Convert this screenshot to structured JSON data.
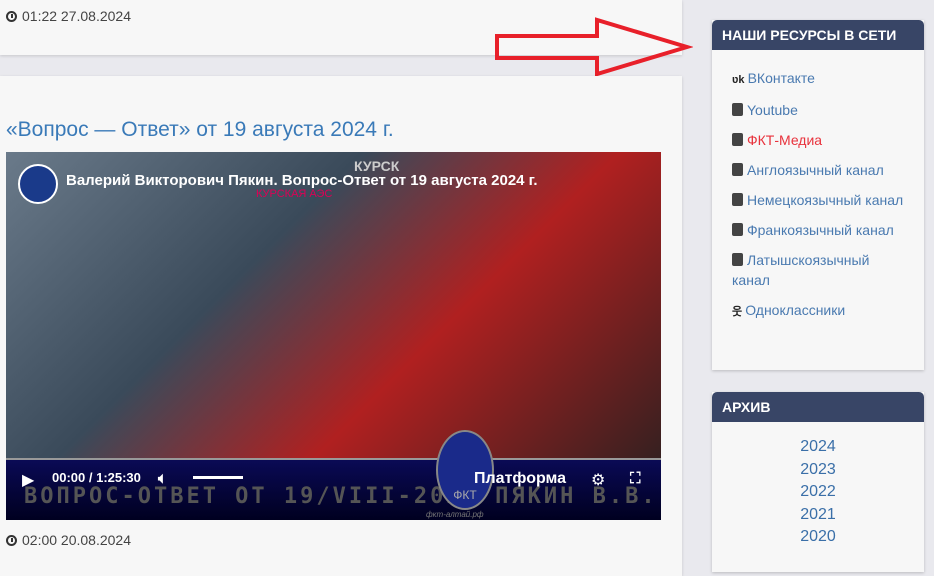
{
  "prev_post": {
    "date": "01:22 27.08.2024"
  },
  "post": {
    "title": "«Вопрос — Ответ» от 19 августа 2024 г.",
    "date": "02:00 20.08.2024",
    "video": {
      "title": "Валерий Викторович Пякин. Вопрос-Ответ от 19 августа 2024 г.",
      "time": "00:00 / 1:25:30",
      "banner": "ВОПРОС-ОТВЕТ ОТ 19/VIII-2024   ПЯКИН В.В.",
      "platform": "Платформа",
      "site": "фкт-алтай.рф",
      "logo_text": "ФКТ",
      "map_label": "КУРСК",
      "map_label2": "КУРСКАЯ АЭС"
    }
  },
  "resources": {
    "title": "НАШИ РЕСУРСЫ В СЕТИ",
    "items": [
      {
        "label": "ВКонтакте",
        "icon": "vk-icon"
      },
      {
        "label": "Youtube",
        "icon": "youtube-icon"
      },
      {
        "label": "ФКТ-Медиа",
        "icon": "youtube-icon",
        "color": "#e8323c"
      },
      {
        "label": "Англоязычный канал",
        "icon": "youtube-icon"
      },
      {
        "label": "Немецкоязычный канал",
        "icon": "youtube-icon"
      },
      {
        "label": "Франкоязычный канал",
        "icon": "youtube-icon"
      },
      {
        "label": "Латышскоязычный канал",
        "icon": "youtube-icon"
      },
      {
        "label": "Одноклассники",
        "icon": "odnoklassniki-icon"
      }
    ]
  },
  "archive": {
    "title": "АРХИВ",
    "years": [
      "2024",
      "2023",
      "2022",
      "2021",
      "2020"
    ]
  },
  "colors": {
    "arrow": "#e8202a",
    "header": "#384566",
    "link": "#4a7ab0"
  }
}
